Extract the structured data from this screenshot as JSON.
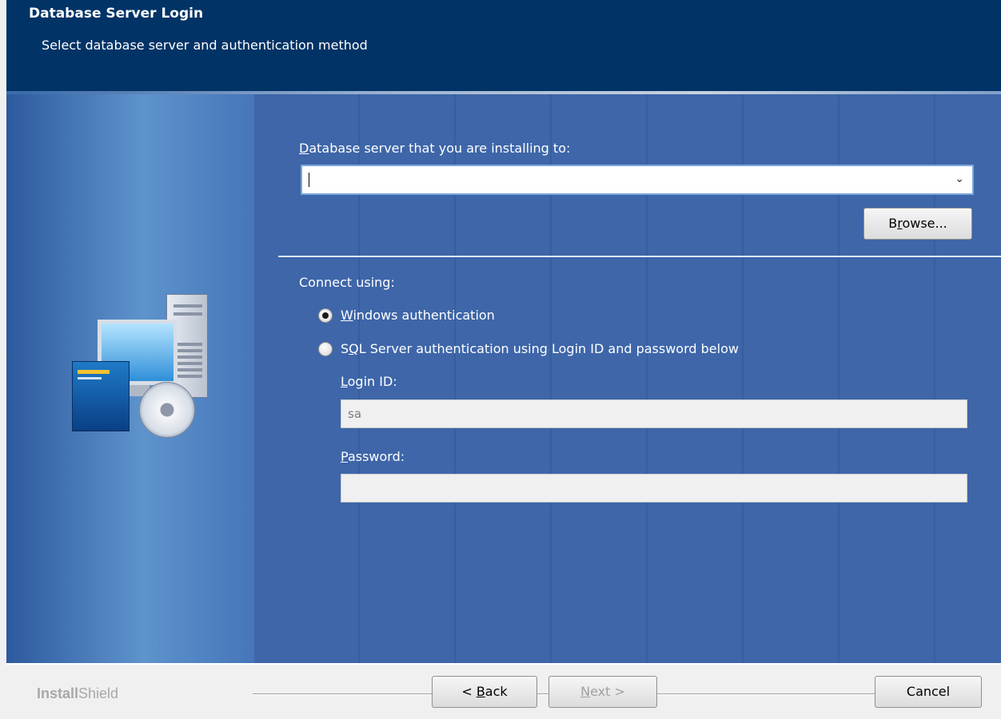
{
  "header": {
    "title": "Database Server Login",
    "subtitle": "Select database server and authentication method"
  },
  "server": {
    "label": "Database server that you are installing to:",
    "value": "",
    "browse_label": "Browse..."
  },
  "auth": {
    "connect_label": "Connect using:",
    "windows_label": "Windows authentication",
    "sql_label": "SQL Server authentication using Login ID and password below",
    "selected": "windows"
  },
  "credentials": {
    "login_label": "Login ID:",
    "login_value": "sa",
    "password_label": "Password:",
    "password_value": ""
  },
  "footer": {
    "brand_bold": "Install",
    "brand_light": "Shield",
    "back_label": "< Back",
    "next_label": "Next >",
    "cancel_label": "Cancel"
  },
  "colors": {
    "header_bg": "#013366",
    "panel_bg": "#3e66a9",
    "footer_bg": "#f0f0f0"
  },
  "icons": [
    "computer-setup-icon",
    "dropdown-arrow-icon",
    "radio-selected-icon",
    "radio-unselected-icon"
  ]
}
